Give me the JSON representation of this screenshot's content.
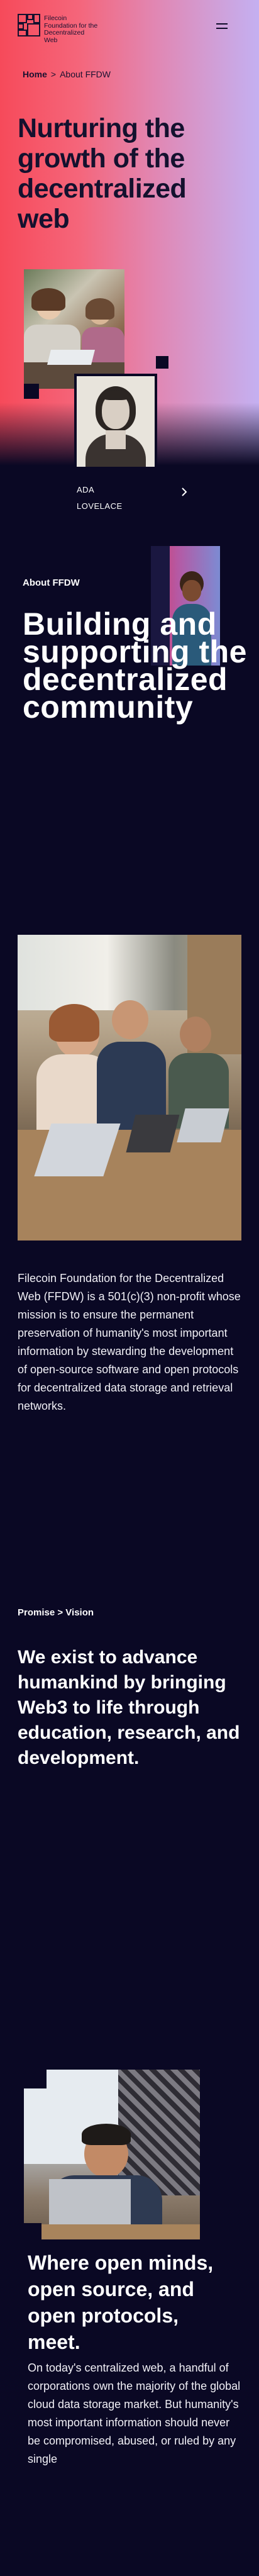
{
  "header": {
    "logo_lines": [
      "Filecoin",
      "Foundation for the",
      "Decentralized",
      "Web"
    ],
    "menu_icon": "hamburger-icon"
  },
  "breadcrumb": {
    "home": "Home",
    "separator": ">",
    "current": "About FFDW"
  },
  "hero": {
    "title": "Nurturing the growth of the decentralized web",
    "featured_name_line1": "ADA",
    "featured_name_line2": "LOVELACE",
    "arrow_icon": "chevron-right-icon"
  },
  "about": {
    "label": "About FFDW",
    "title": "Building and supporting the decentralized community"
  },
  "mission": {
    "text": "Filecoin Foundation for the Decentralized Web (FFDW) is a 501(c)(3) non-profit whose mission is to ensure the permanent preservation of humanity's most important information by stewarding the development of open-source software and open protocols for decentralized data storage and retrieval networks."
  },
  "promise": {
    "label": "Promise > Vision",
    "title": "We exist to advance humankind by bringing Web3 to life through education, research, and development."
  },
  "open": {
    "title": "Where open minds, open source, and open protocols, meet.",
    "body": "On today's centralized web, a handful of corporations own the majority of the global cloud data storage market. But humanity's most important information should never be compromised, abused, or ruled by any single"
  },
  "colors": {
    "background": "#0a0824",
    "hero_gradient_start": "#f64a5a",
    "hero_gradient_end": "#c4b0f1"
  }
}
